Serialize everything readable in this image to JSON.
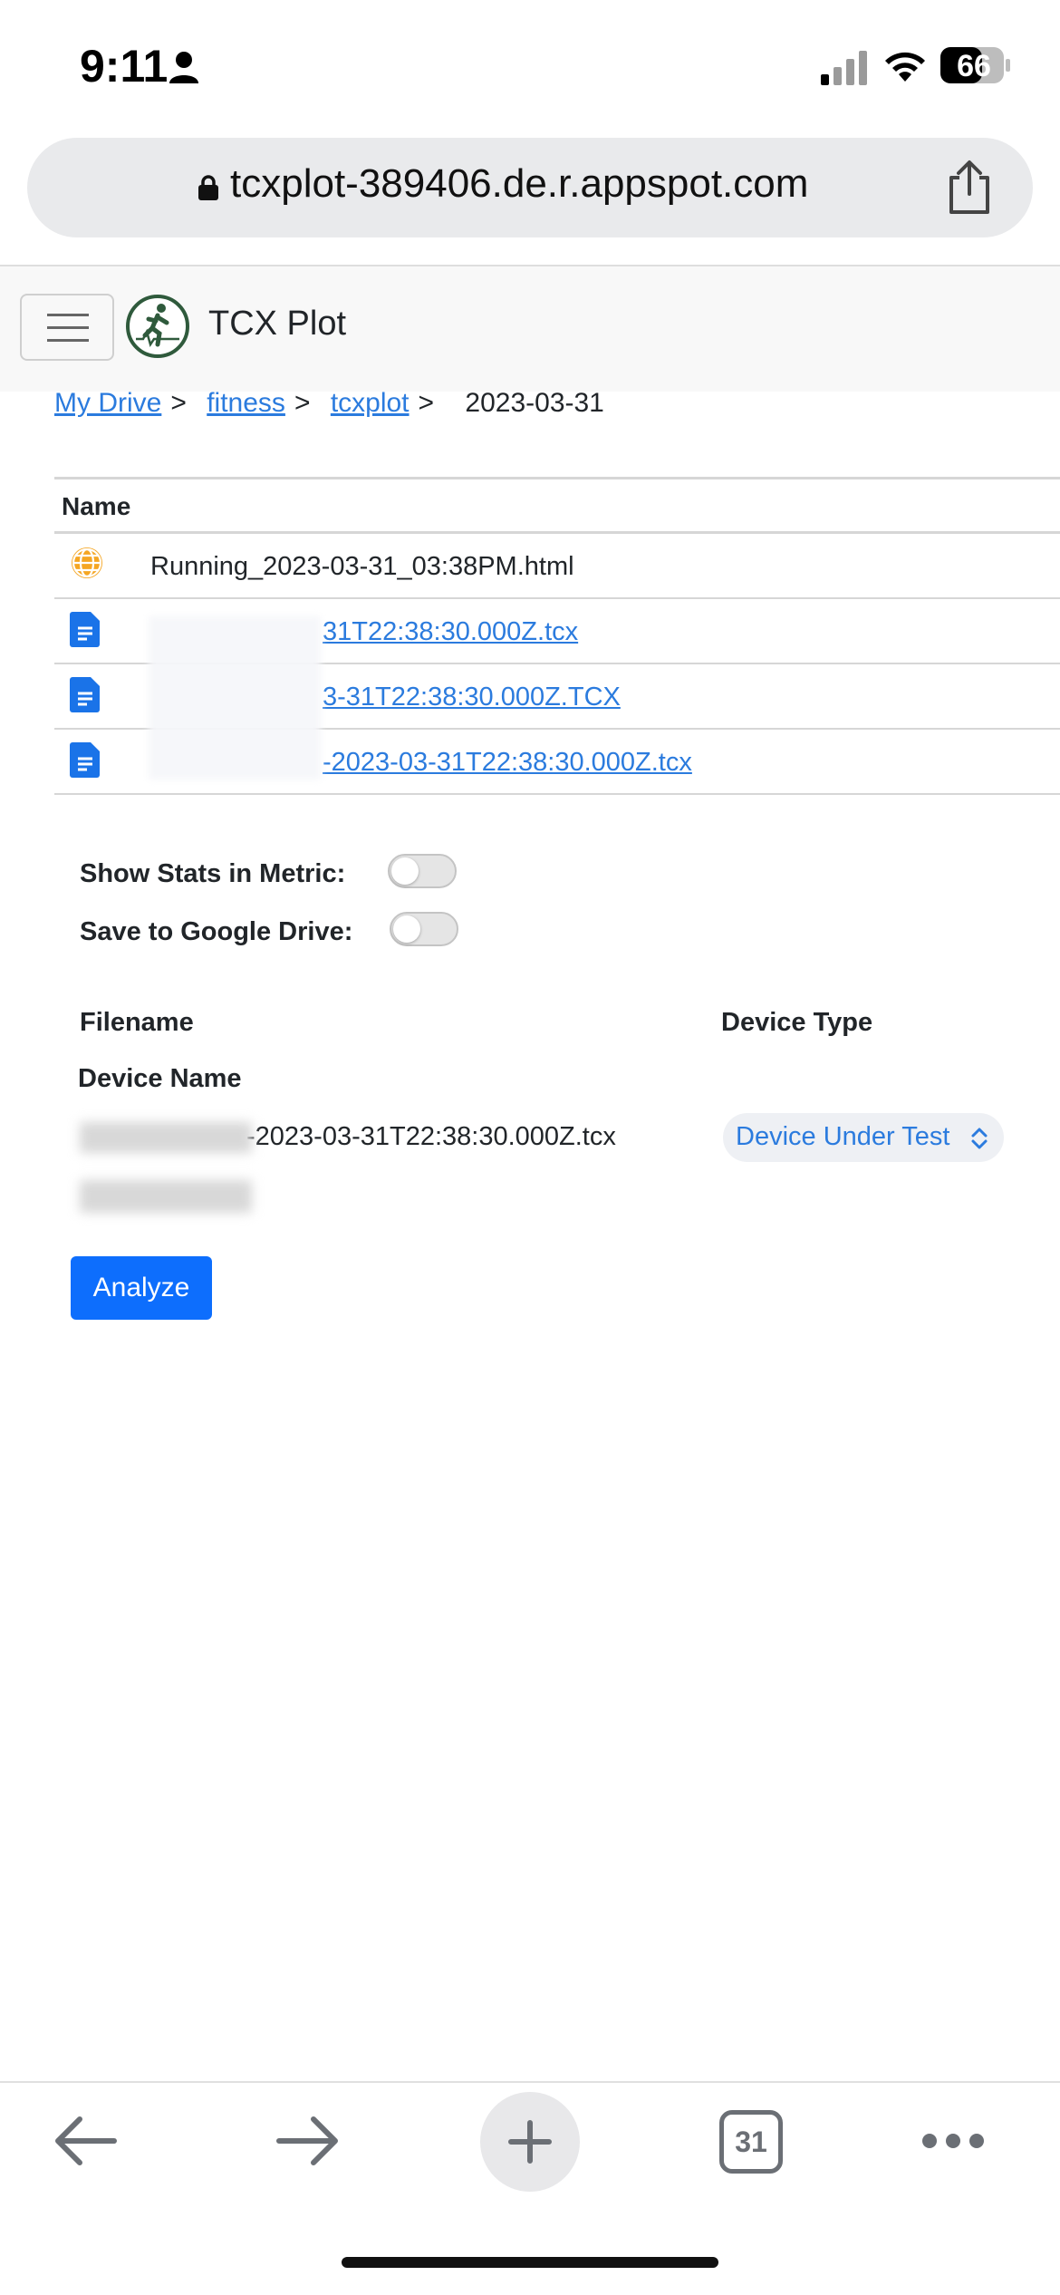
{
  "status_bar": {
    "time": "9:11",
    "battery": "66",
    "icons": [
      "person-icon",
      "cellular-signal-icon",
      "wifi-icon",
      "battery-icon"
    ]
  },
  "browser": {
    "url": "tcxplot-389406.de.r.appspot.com",
    "icons": [
      "lock-icon",
      "share-icon"
    ]
  },
  "navbar": {
    "brand": "TCX Plot",
    "icons": [
      "hamburger-menu-icon",
      "runner-logo-icon"
    ]
  },
  "breadcrumb": {
    "items": [
      "My Drive",
      "fitness",
      "tcxplot"
    ],
    "separator": ">",
    "current": "2023-03-31"
  },
  "files": {
    "header": "Name",
    "rows": [
      {
        "icon": "globe-icon",
        "name": "Running_2023-03-31_03:38PM.html",
        "link": false
      },
      {
        "icon": "document-icon",
        "name": "31T22:38:30.000Z.tcx",
        "link": true
      },
      {
        "icon": "document-icon",
        "name": "3-31T22:38:30.000Z.TCX",
        "link": true
      },
      {
        "icon": "document-icon",
        "name": "-2023-03-31T22:38:30.000Z.tcx",
        "link": true
      }
    ]
  },
  "options": {
    "metric_label": "Show Stats in Metric:",
    "metric_on": false,
    "drive_label": "Save to Google Drive:",
    "drive_on": false
  },
  "devices": {
    "filename_header": "Filename",
    "device_type_header": "Device Type",
    "device_name_header": "Device Name",
    "filename": "-2023-03-31T22:38:30.000Z.tcx",
    "device_type": "Device Under Test"
  },
  "actions": {
    "analyze": "Analyze"
  },
  "toolbar": {
    "tab_count": "31",
    "icons": [
      "back-arrow-icon",
      "forward-arrow-icon",
      "new-tab-plus-icon",
      "tabs-icon",
      "more-icon"
    ]
  },
  "colors": {
    "link": "#2b7bde",
    "primary_button": "#0d6efd",
    "globe": "#f5a623",
    "document": "#1a73e8"
  }
}
